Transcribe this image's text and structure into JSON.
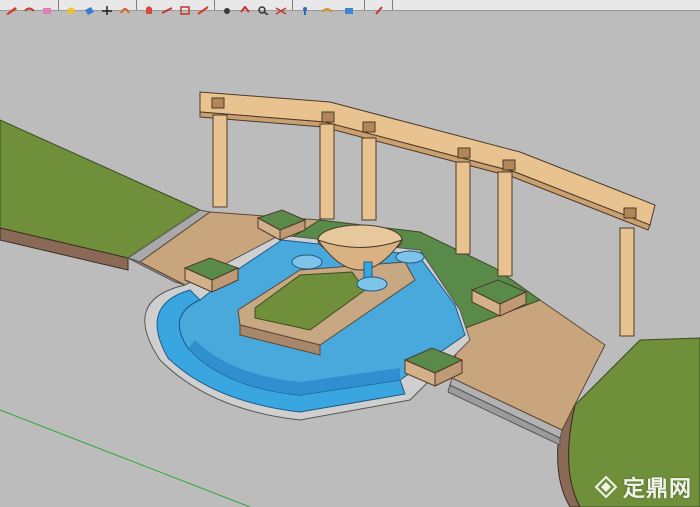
{
  "window": {
    "title": ""
  },
  "toolbar": {
    "buttons": [
      {
        "name": "pencil-icon"
      },
      {
        "name": "undo-icon"
      },
      {
        "name": "eraser-icon"
      },
      {
        "name": "tape-measure-icon"
      },
      {
        "name": "paint-bucket-icon"
      },
      {
        "name": "move-icon"
      },
      {
        "name": "rotate-icon"
      },
      {
        "name": "push-pull-icon"
      },
      {
        "name": "follow-me-icon"
      },
      {
        "name": "scale-icon"
      },
      {
        "name": "offset-icon"
      },
      {
        "name": "orbit-icon"
      },
      {
        "name": "pan-icon"
      },
      {
        "name": "zoom-icon"
      },
      {
        "name": "zoom-extents-icon"
      },
      {
        "name": "walk-icon"
      }
    ]
  },
  "viewport": {
    "colors": {
      "background": "#bcbcbc",
      "grass": "#6f8f3a",
      "paving": "#c9a57e",
      "water": "#4aa9dc",
      "pergola": "#e8c38f",
      "stone": "#b5b5b5"
    },
    "axis": {
      "green": "#2fa83a"
    }
  },
  "watermark": {
    "text": "定鼎网"
  }
}
